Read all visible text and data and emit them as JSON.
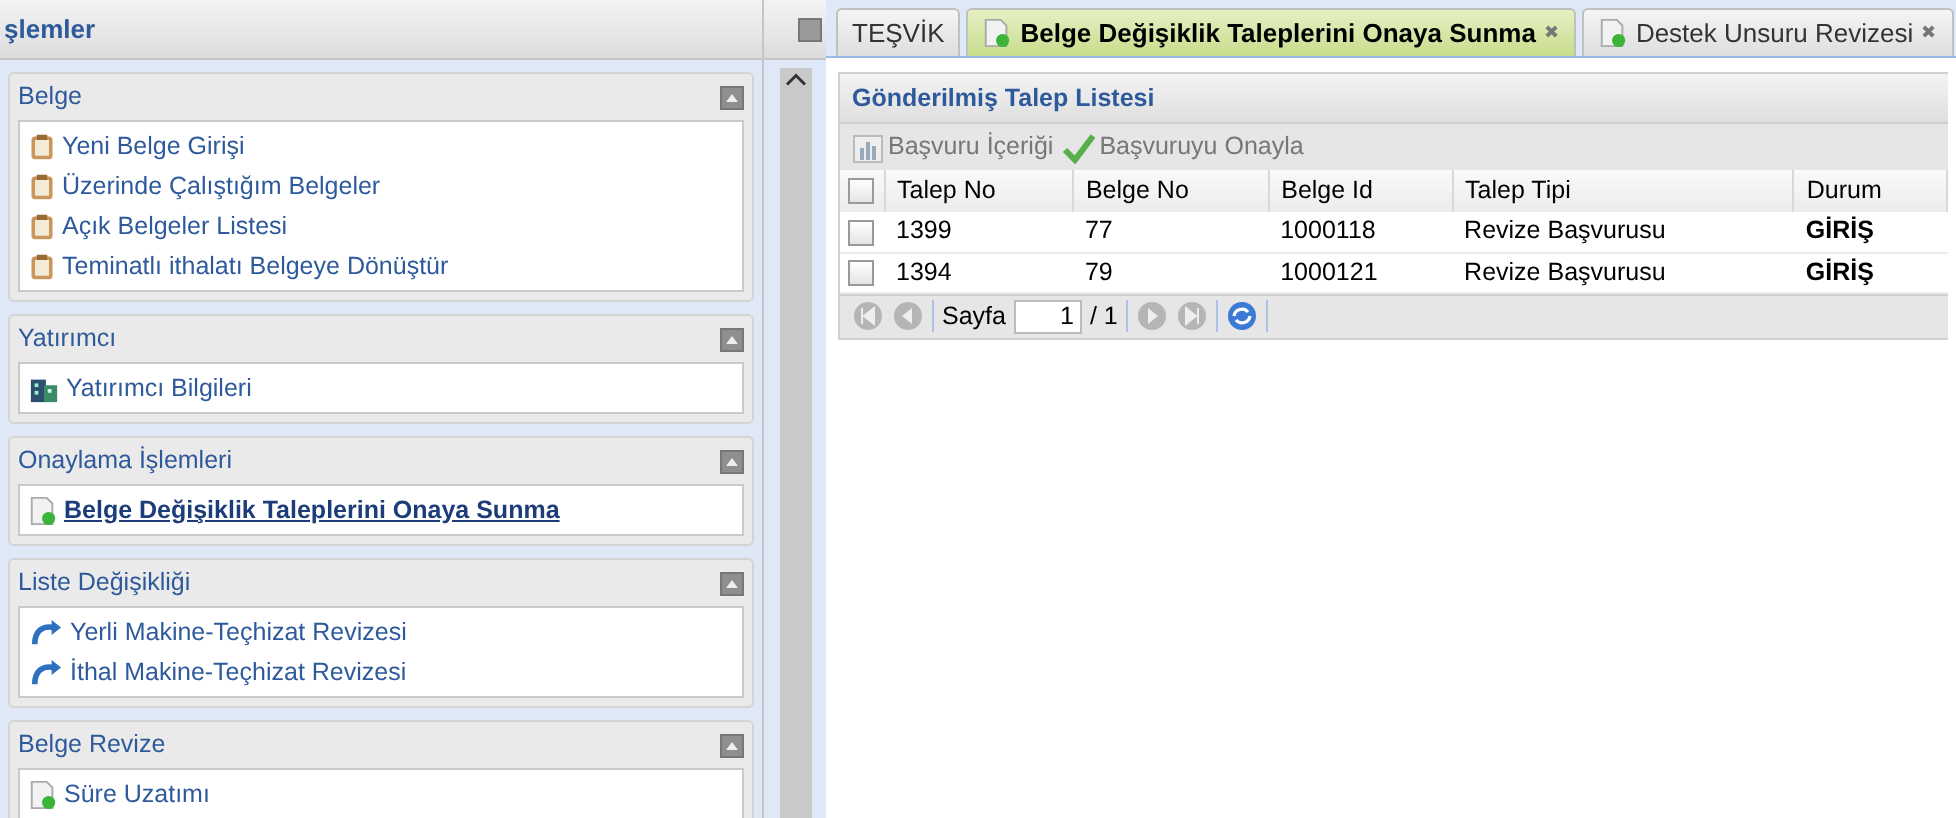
{
  "sidebar": {
    "title": "şlemler",
    "sections": [
      {
        "title": "Belge",
        "items": [
          {
            "label": "Yeni Belge Girişi",
            "kind": "clipboard",
            "selected": false
          },
          {
            "label": "Üzerinde Çalıştığım Belgeler",
            "kind": "clipboard",
            "selected": false
          },
          {
            "label": "Açık Belgeler Listesi",
            "kind": "clipboard",
            "selected": false
          },
          {
            "label": "Teminatlı ithalatı Belgeye Dönüştür",
            "kind": "clipboard",
            "selected": false
          }
        ]
      },
      {
        "title": "Yatırımcı",
        "items": [
          {
            "label": "Yatırımcı Bilgileri",
            "kind": "building",
            "selected": false
          }
        ]
      },
      {
        "title": "Onaylama İşlemleri",
        "items": [
          {
            "label": "Belge Değişiklik Taleplerini Onaya Sunma",
            "kind": "document",
            "selected": true
          }
        ]
      },
      {
        "title": "Liste Değişikliği",
        "items": [
          {
            "label": "Yerli Makine-Teçhizat Revizesi",
            "kind": "arrow",
            "selected": false
          },
          {
            "label": "İthal Makine-Teçhizat Revizesi",
            "kind": "arrow",
            "selected": false
          }
        ]
      },
      {
        "title": "Belge Revize",
        "items": [
          {
            "label": "Süre Uzatımı",
            "kind": "document",
            "selected": false
          }
        ]
      }
    ]
  },
  "tabs": [
    {
      "label": "TEŞVİK",
      "kind": "plain",
      "closable": false,
      "selected": false
    },
    {
      "label": "Belge Değişiklik Taleplerini Onaya Sunma",
      "kind": "document",
      "closable": true,
      "selected": true
    },
    {
      "label": "Destek Unsuru Revizesi",
      "kind": "document",
      "closable": true,
      "selected": false
    }
  ],
  "close_glyph": "✖",
  "panel": {
    "title": "Gönderilmiş Talep Listesi",
    "toolbar": [
      {
        "label": "Başvuru İçeriği",
        "kind": "report",
        "disabled": true
      },
      {
        "label": "Başvuruyu Onayla",
        "kind": "check",
        "disabled": true
      }
    ],
    "table": {
      "select_all_checked": false,
      "columns": [
        "Talep No",
        "Belge No",
        "Belge Id",
        "Talep Tipi",
        "Durum"
      ],
      "rows": [
        {
          "checked": false,
          "cells": [
            "1399",
            "77",
            "1000118",
            "Revize Başvurusu",
            "GİRİŞ"
          ]
        },
        {
          "checked": false,
          "cells": [
            "1394",
            "79",
            "1000121",
            "Revize Başvurusu",
            "GİRİŞ"
          ]
        }
      ]
    },
    "pager": {
      "label": "Sayfa",
      "page": "1",
      "total": "/ 1"
    }
  }
}
